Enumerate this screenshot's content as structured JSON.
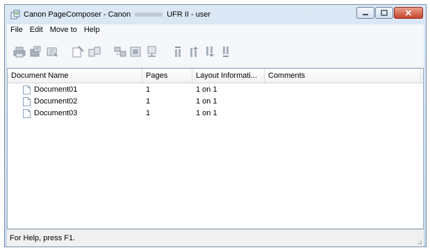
{
  "window": {
    "title_prefix": "Canon PageComposer - Canon",
    "title_suffix": "UFR II - user"
  },
  "icons": {
    "app": "page-composer-app-icon",
    "minimize": "minimize-icon",
    "maximize": "maximize-icon",
    "close": "close-icon"
  },
  "menu": [
    "File",
    "Edit",
    "Move to",
    "Help"
  ],
  "toolbar_icons": [
    "print-icon",
    "print-preview-icon",
    "properties-icon",
    "edit-document-icon",
    "combine-documents-icon",
    "split-documents-icon",
    "delete-document-icon",
    "export-icon",
    "move-top-icon",
    "move-up-icon",
    "move-down-icon",
    "move-bottom-icon"
  ],
  "list": {
    "columns": [
      "Document Name",
      "Pages",
      "Layout Informati...",
      "Comments"
    ],
    "rows": [
      {
        "name": "Document01",
        "pages": "1",
        "layout": "1 on 1",
        "comments": ""
      },
      {
        "name": "Document02",
        "pages": "1",
        "layout": "1 on 1",
        "comments": ""
      },
      {
        "name": "Document03",
        "pages": "1",
        "layout": "1 on 1",
        "comments": ""
      }
    ]
  },
  "status": {
    "text": "For Help, press F1."
  },
  "colors": {
    "title_gradient_top": "#dce8f5",
    "close_button": "#c8442c",
    "toolbar_icon": "#8c96a3"
  }
}
